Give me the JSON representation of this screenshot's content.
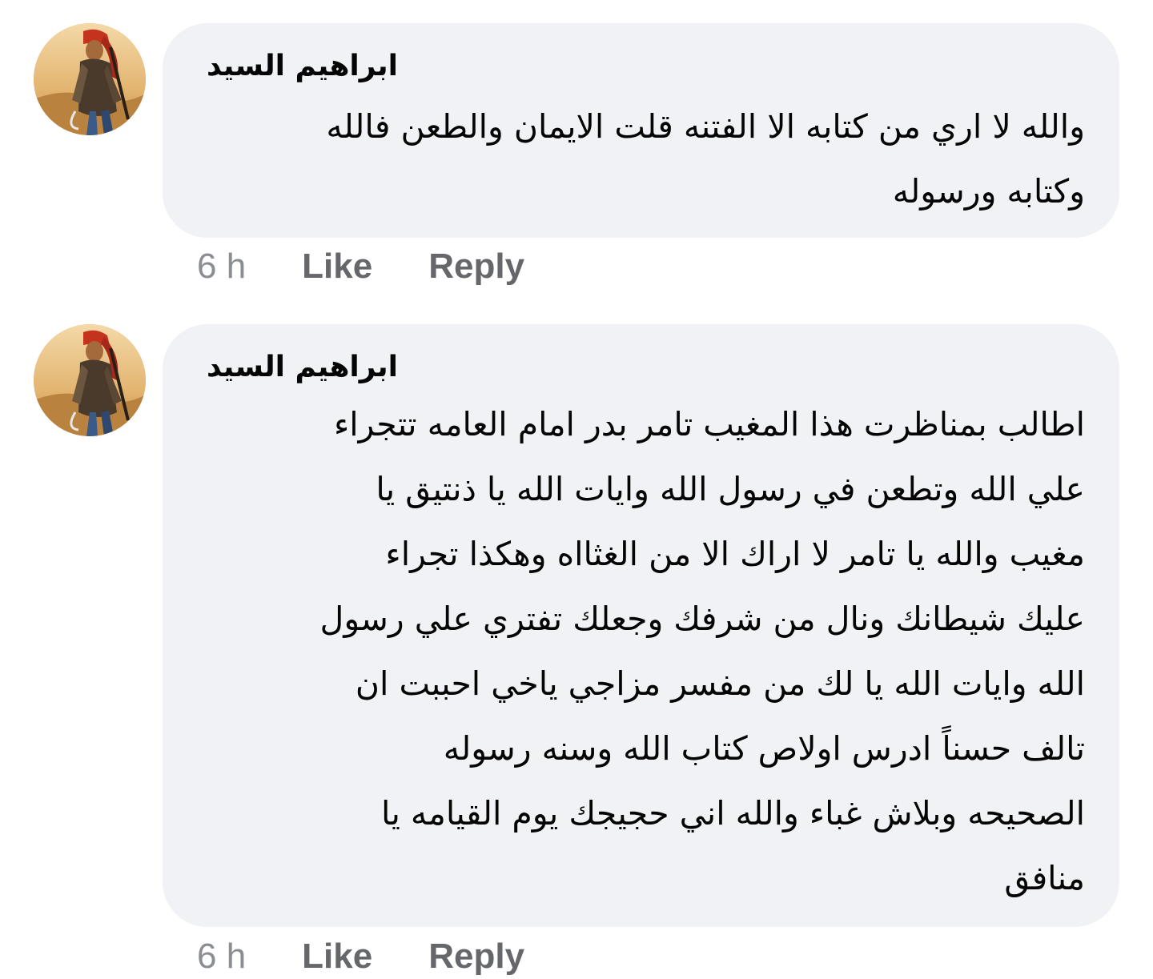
{
  "comments": [
    {
      "author": "ابراهيم السيد",
      "avatar_icon": "warrior-avatar",
      "text_lines": [
        "والله لا اري من كتابه الا الفتنه قلت الايمان والطعن فالله",
        "وكتابه ورسوله"
      ],
      "time": "6 h",
      "like_label": "Like",
      "reply_label": "Reply"
    },
    {
      "author": "ابراهيم السيد",
      "avatar_icon": "warrior-avatar",
      "text_lines": [
        "اطالب بمناظرت هذا المغيب تامر بدر امام العامه تتجراء",
        "علي الله وتطعن في رسول الله وايات الله يا ذنتيق يا",
        "مغيب والله يا تامر لا اراك الا من الغثااه وهكذا تجراء",
        "عليك شيطانك ونال من شرفك وجعلك تفتري علي رسول",
        "الله وايات الله يا لك من مفسر مزاجي ياخي احببت ان",
        "تالف حسناً ادرس اولاص كتاب الله وسنه رسوله",
        "الصحيحه وبلاش غباء والله اني حجيجك يوم القيامه يا",
        "منافق"
      ],
      "time": "6 h",
      "like_label": "Like",
      "reply_label": "Reply"
    }
  ],
  "colors": {
    "bubble": "#f0f2f5",
    "text": "#050505",
    "action": "#65676b",
    "time": "#8a8d91"
  }
}
